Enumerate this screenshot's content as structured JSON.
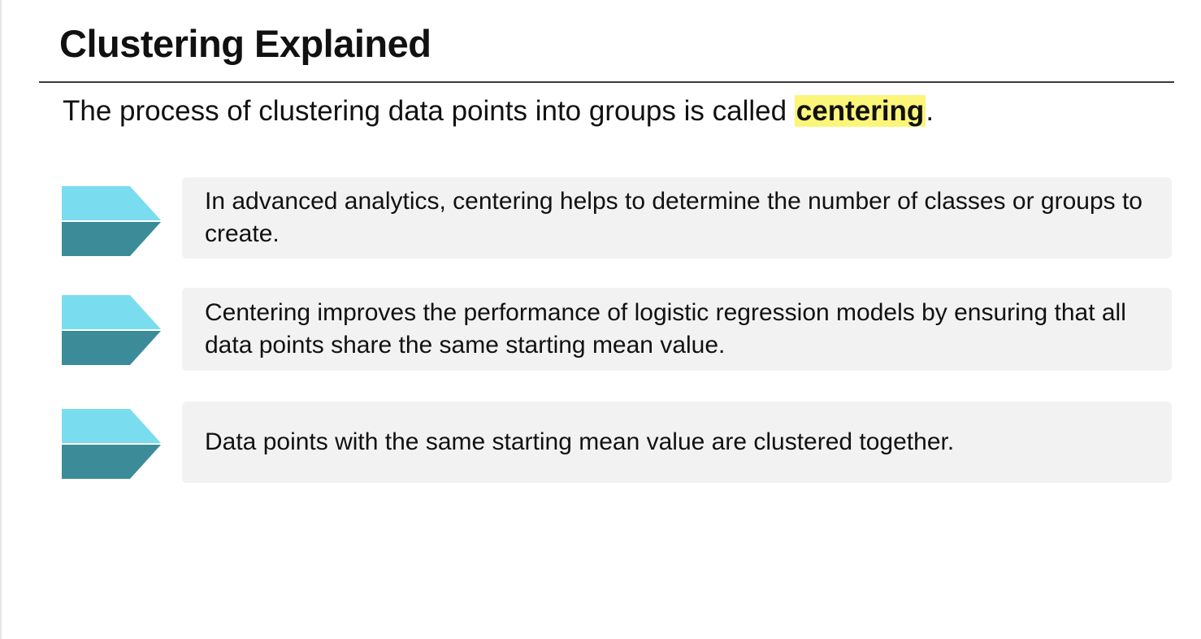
{
  "slide": {
    "title": "Clustering Explained",
    "subtitle": {
      "before": "The process of clustering data points into groups is called ",
      "highlight": "centering",
      "after": "."
    },
    "items": [
      {
        "text": "In advanced analytics, centering helps to determine the number of classes or groups to create."
      },
      {
        "text": "Centering improves the performance of logistic regression models by ensuring that all data points share the same starting mean value."
      },
      {
        "text": "Data points with the same starting mean value are clustered together."
      }
    ]
  },
  "colors": {
    "arrow_top": "#7adcef",
    "arrow_bottom": "#3b8c98",
    "highlight": "#fbf57a",
    "card_background": "#f2f2f2"
  }
}
